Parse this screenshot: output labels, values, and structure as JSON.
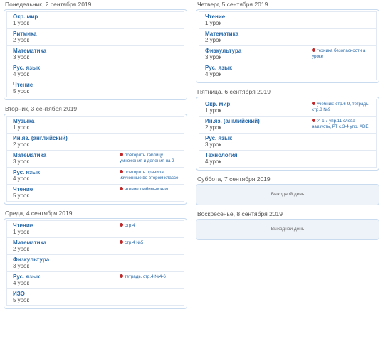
{
  "left_column": [
    {
      "title": "Понедельник, 2 сентября 2019",
      "lessons": [
        {
          "subject": "Окр. мир",
          "number": "1 урок",
          "homework": ""
        },
        {
          "subject": "Ритмика",
          "number": "2 урок",
          "homework": ""
        },
        {
          "subject": "Математика",
          "number": "3 урок",
          "homework": ""
        },
        {
          "subject": "Рус. язык",
          "number": "4 урок",
          "homework": ""
        },
        {
          "subject": "Чтение",
          "number": "5 урок",
          "homework": ""
        }
      ]
    },
    {
      "title": "Вторник, 3 сентября 2019",
      "lessons": [
        {
          "subject": "Музыка",
          "number": "1 урок",
          "homework": ""
        },
        {
          "subject": "Ин.яз. (английский)",
          "number": "2 урок",
          "homework": ""
        },
        {
          "subject": "Математика",
          "number": "3 урок",
          "homework": "повторить таблицу умножения и деления на 2"
        },
        {
          "subject": "Рус. язык",
          "number": "4 урок",
          "homework": "повторить правила, изученные во втором классе"
        },
        {
          "subject": "Чтение",
          "number": "5 урок",
          "homework": "чтение любимых книг"
        }
      ]
    },
    {
      "title": "Среда, 4 сентября 2019",
      "lessons": [
        {
          "subject": "Чтение",
          "number": "1 урок",
          "homework": "стр.4"
        },
        {
          "subject": "Математика",
          "number": "2 урок",
          "homework": "стр.4 №5"
        },
        {
          "subject": "Физкультура",
          "number": "3 урок",
          "homework": ""
        },
        {
          "subject": "Рус. язык",
          "number": "4 урок",
          "homework": "тетрадь, стр.4 №4-6"
        },
        {
          "subject": "ИЗО",
          "number": "5 урок",
          "homework": ""
        }
      ]
    }
  ],
  "right_column": [
    {
      "title": "Четверг, 5 сентября 2019",
      "lessons": [
        {
          "subject": "Чтение",
          "number": "1 урок",
          "homework": ""
        },
        {
          "subject": "Математика",
          "number": "2 урок",
          "homework": ""
        },
        {
          "subject": "Физкультура",
          "number": "3 урок",
          "homework": "техника безопасности а уроке"
        },
        {
          "subject": "Рус. язык",
          "number": "4 урок",
          "homework": ""
        }
      ]
    },
    {
      "title": "Пятница, 6 сентября 2019",
      "lessons": [
        {
          "subject": "Окр. мир",
          "number": "1 урок",
          "homework": "учебник: стр.6-9, тетрадь. стр.8 №9"
        },
        {
          "subject": "Ин.яз. (английский)",
          "number": "2 урок",
          "homework": "У: с.7 упр.11 слова наизусть, РТ с.3-4 упр. ADE"
        },
        {
          "subject": "Рус. язык",
          "number": "3 урок",
          "homework": ""
        },
        {
          "subject": "Технология",
          "number": "4 урок",
          "homework": ""
        }
      ]
    },
    {
      "title": "Суббота, 7 сентября 2019",
      "weekend": "Выходной день"
    },
    {
      "title": "Воскресенье, 8 сентября 2019",
      "weekend": "Выходной день"
    }
  ]
}
